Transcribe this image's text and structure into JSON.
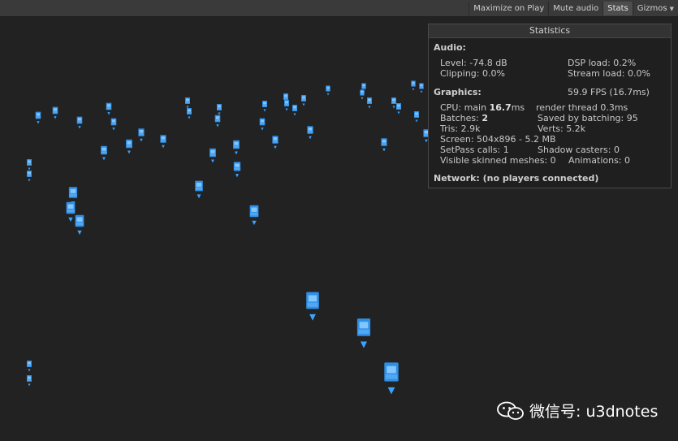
{
  "toolbar": {
    "maximize_on_play": "Maximize on Play",
    "mute_audio": "Mute audio",
    "stats": "Stats",
    "gizmos": "Gizmos",
    "gizmos_arrow_icon": "dropdown-arrow"
  },
  "stats": {
    "title": "Statistics",
    "audio": {
      "header": "Audio:",
      "level": "Level: -74.8 dB",
      "clipping": "Clipping: 0.0%",
      "dsp_load": "DSP load: 0.2%",
      "stream_load": "Stream load: 0.0%"
    },
    "graphics": {
      "header": "Graphics:",
      "fps": "59.9 FPS (16.7ms)",
      "cpu_prefix": "CPU: main ",
      "cpu_main_value": "16.7",
      "cpu_suffix": "ms",
      "render_thread": "render thread 0.3ms",
      "batches_prefix": "Batches: ",
      "batches_value": "2",
      "saved_by_batching": "Saved by batching: 95",
      "tris": "Tris: 2.9k",
      "verts": "Verts: 5.2k",
      "screen": "Screen: 504x896 - 5.2 MB",
      "setpass": "SetPass calls: 1",
      "shadow_casters": "Shadow casters: 0",
      "visible_skinned": "Visible skinned meshes: 0",
      "animations": "Animations: 0"
    },
    "network": "Network: (no players connected)"
  },
  "watermark": {
    "text": "微信号: u3dnotes",
    "icon": "wechat-icon"
  },
  "colors": {
    "background": "#222222",
    "sprite_blue": "#2f8fe8",
    "sprite_light": "#7cc6ff"
  }
}
